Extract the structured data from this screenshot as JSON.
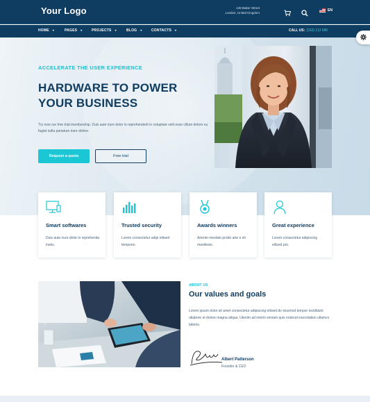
{
  "header": {
    "logo": "Your Logo",
    "address_line1": "139 Baker Street",
    "address_line2": "London, United Kingdom",
    "language": "EN",
    "icons": [
      "cart-icon",
      "search-icon",
      "us-flag-icon"
    ]
  },
  "nav": {
    "items": [
      {
        "label": "HOME"
      },
      {
        "label": "PAGES"
      },
      {
        "label": "PROJECTS"
      },
      {
        "label": "BLOG"
      },
      {
        "label": "CONTACTS"
      }
    ],
    "call_label": "CALL US:",
    "call_number": "(033) 113 586"
  },
  "hero": {
    "eyebrow": "ACCELERATE THE USER EXPERIENCE",
    "title_line1": "HARDWARE TO POWER",
    "title_line2": "YOUR BUSINESS",
    "description": "Try now our free trial membership. Duis aute irure dolor in reprehenderit in voluptate velit esse cillum dolore eu fugiat nulla pariature irure dolore.",
    "primary_button": "Request a quote",
    "secondary_button": "Free trial"
  },
  "features": [
    {
      "title": "Smart softwares",
      "description": "Duis aute irure dolor in reprehenita ineks.",
      "icon": "monitor-icon"
    },
    {
      "title": "Trusted security",
      "description": "Lorem consectetur adipi elitsed tempono.",
      "icon": "bar-chart-icon"
    },
    {
      "title": "Awards winners",
      "description": "Ariento mesfato prodo arte e eli manifesto.",
      "icon": "award-medal-icon"
    },
    {
      "title": "Great experience",
      "description": "Lorem consectetur adipiscing elitsed pro.",
      "icon": "user-icon"
    }
  ],
  "about": {
    "eyebrow": "ABOUT US",
    "title": "Our values and goals",
    "description": "Lorem ipsum dolor sit amet consectetur adipiscing elitsed do eiusmod tempor incididunt utlabore et dolore magna aliqua. Utenim ad minim veniam quis nostrud exercitation ullamco laboris.",
    "signature_name": "Albert Patterson",
    "signature_role": "Founder & CEO"
  },
  "colors": {
    "navy": "#0f3c61",
    "accent": "#1bc7d5",
    "text_muted": "#4c6479"
  }
}
